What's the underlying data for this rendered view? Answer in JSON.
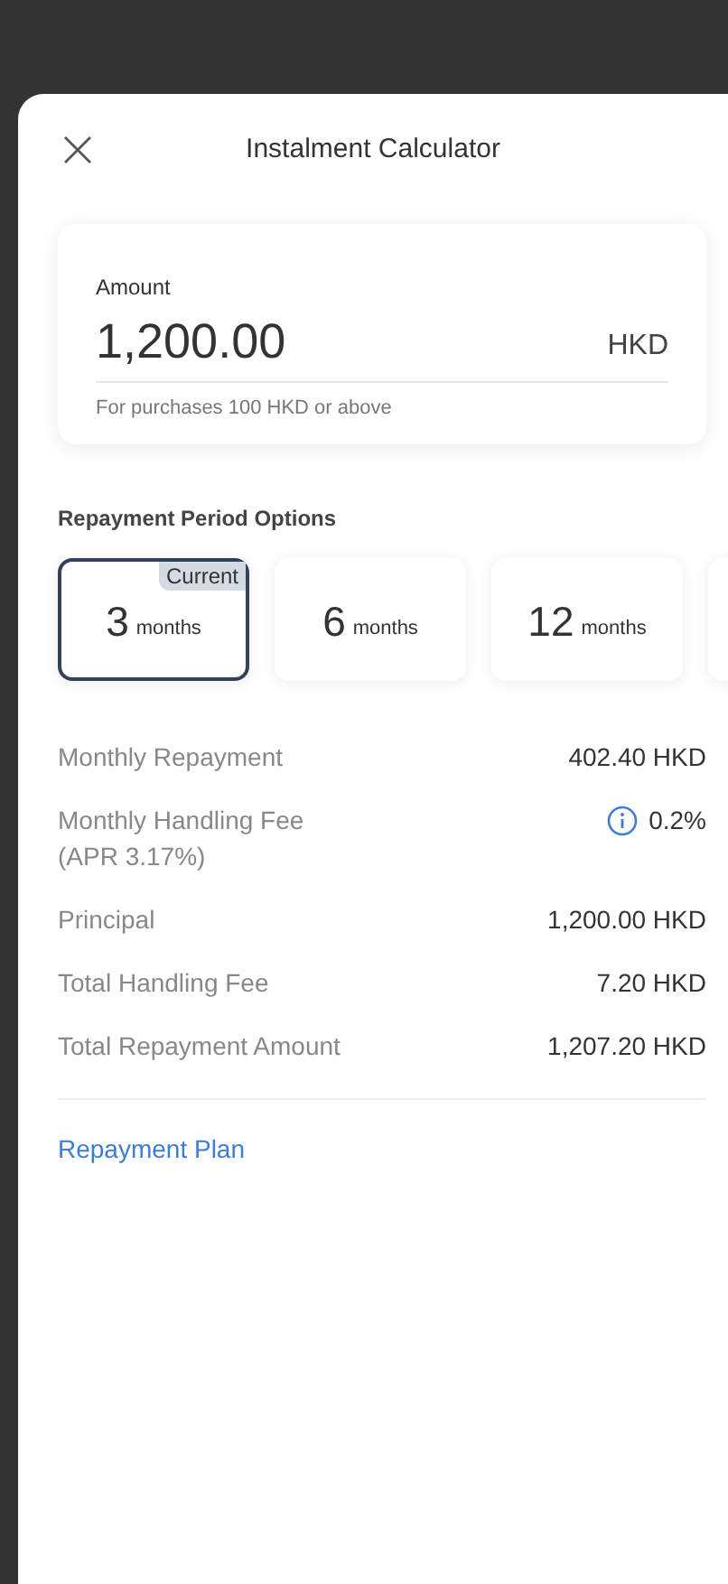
{
  "header": {
    "title": "Instalment Calculator"
  },
  "amount": {
    "label": "Amount",
    "value": "1,200.00",
    "currency": "HKD",
    "hint": "For purchases 100 HKD or above"
  },
  "period": {
    "title": "Repayment Period Options",
    "options": [
      {
        "number": "3",
        "unit": "months",
        "selected": true,
        "badge": "Current"
      },
      {
        "number": "6",
        "unit": "months",
        "selected": false
      },
      {
        "number": "12",
        "unit": "months",
        "selected": false
      }
    ]
  },
  "details": [
    {
      "label": "Monthly Repayment",
      "value": "402.40 HKD",
      "info": false
    },
    {
      "label": "Monthly Handling Fee",
      "sublabel": "(APR 3.17%)",
      "value": "0.2%",
      "info": true
    },
    {
      "label": "Principal",
      "value": "1,200.00 HKD",
      "info": false
    },
    {
      "label": "Total Handling Fee",
      "value": "7.20 HKD",
      "info": false
    },
    {
      "label": "Total Repayment Amount",
      "value": "1,207.20 HKD",
      "info": false
    }
  ],
  "link": "Repayment Plan"
}
